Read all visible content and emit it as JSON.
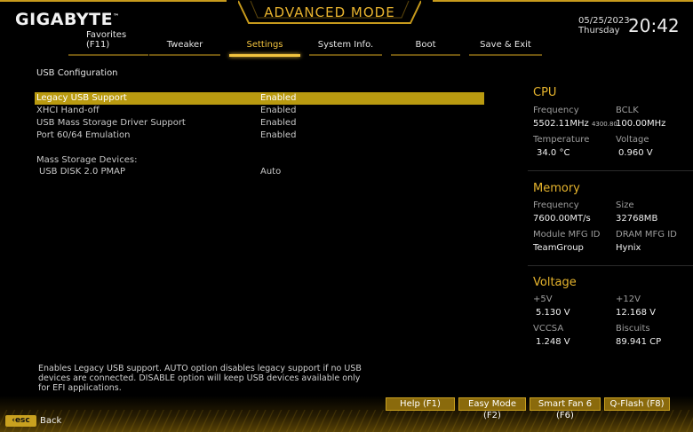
{
  "header": {
    "brand": "GIGABYTE",
    "brand_mark": "™",
    "mode_title": "ADVANCED MODE",
    "date": "05/25/2023",
    "weekday": "Thursday",
    "time": "20:42"
  },
  "tabs": {
    "favorites_line1": "Favorites",
    "favorites_line2": "(F11)",
    "tweaker": "Tweaker",
    "settings": "Settings",
    "system_info": "System Info.",
    "boot": "Boot",
    "save_exit": "Save & Exit"
  },
  "section_title": "USB Configuration",
  "settings": [
    {
      "label": "Legacy USB Support",
      "value": "Enabled"
    },
    {
      "label": "XHCI Hand-off",
      "value": "Enabled"
    },
    {
      "label": "USB Mass Storage Driver Support",
      "value": "Enabled"
    },
    {
      "label": "Port 60/64 Emulation",
      "value": "Enabled"
    }
  ],
  "mass_storage": {
    "heading": "Mass Storage Devices:",
    "device_label": "USB DISK 2.0 PMAP",
    "device_value": "Auto"
  },
  "cpu": {
    "title": "CPU",
    "frequency_label": "Frequency",
    "frequency_value": "5502.11MHz",
    "frequency_sub": "4300.80",
    "bclk_label": "BCLK",
    "bclk_value": "100.00MHz",
    "temperature_label": "Temperature",
    "temperature_value": "34.0 °C",
    "voltage_label": "Voltage",
    "voltage_value": "0.960 V"
  },
  "memory": {
    "title": "Memory",
    "frequency_label": "Frequency",
    "frequency_value": "7600.00MT/s",
    "size_label": "Size",
    "size_value": "32768MB",
    "module_mfg_label": "Module MFG ID",
    "module_mfg_value": "TeamGroup",
    "dram_mfg_label": "DRAM MFG ID",
    "dram_mfg_value": "Hynix"
  },
  "voltage": {
    "title": "Voltage",
    "p5v_label": "+5V",
    "p5v_value": "5.130 V",
    "p12v_label": "+12V",
    "p12v_value": "12.168 V",
    "vccsa_label": "VCCSA",
    "vccsa_value": "1.248 V",
    "biscuits_label": "Biscuits",
    "biscuits_value": "89.941 CP"
  },
  "help_text": "Enables Legacy USB support. AUTO option disables legacy support if no USB devices are connected. DISABLE option will keep USB devices available only for EFI applications.",
  "footer": {
    "help": "Help (F1)",
    "easy_mode": "Easy Mode (F2)",
    "smart_fan": "Smart Fan 6 (F6)",
    "qflash": "Q-Flash (F8)",
    "esc_key": "esc",
    "back": "Back"
  },
  "colors": {
    "accent": "#e7b52d",
    "selection": "#b99a10",
    "background": "#000000"
  }
}
